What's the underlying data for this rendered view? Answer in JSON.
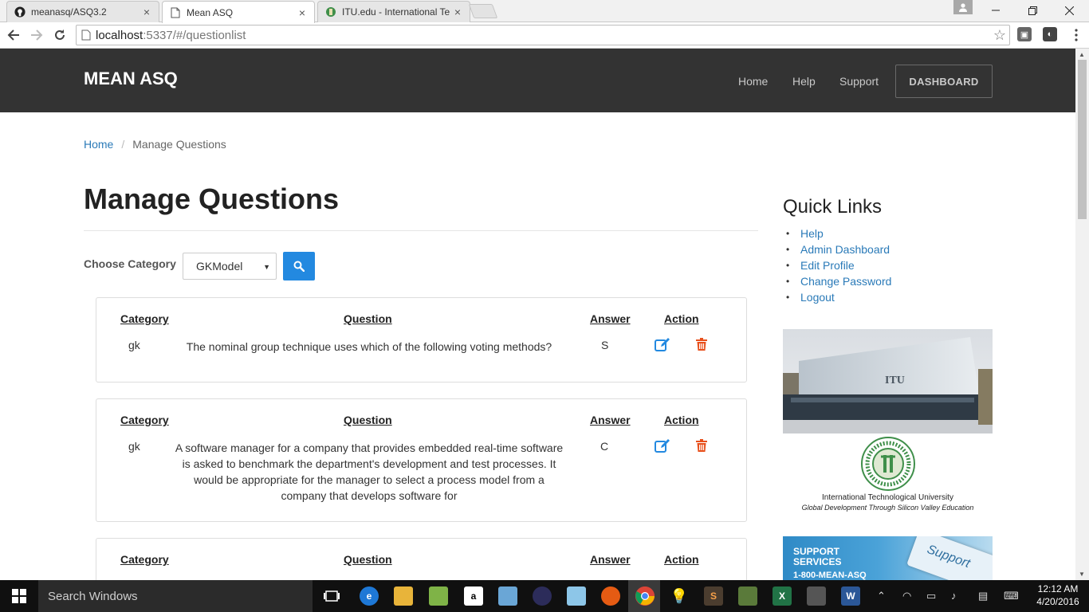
{
  "browser": {
    "tabs": [
      {
        "title": "meanasq/ASQ3.2",
        "icon": "github-icon"
      },
      {
        "title": "Mean ASQ",
        "icon": "page-icon",
        "active": true
      },
      {
        "title": "ITU.edu - International Te",
        "icon": "itu-icon"
      }
    ],
    "close_glyph": "×",
    "url_host": "localhost",
    "url_path": ":5337/#/questionlist"
  },
  "navbar": {
    "brand": "MEAN ASQ",
    "links": [
      "Home",
      "Help",
      "Support"
    ],
    "dashboard_label": "DASHBOARD"
  },
  "breadcrumb": {
    "home": "Home",
    "separator": "/",
    "current": "Manage Questions"
  },
  "main": {
    "title": "Manage Questions",
    "choose_category_label": "Choose Category",
    "selected_category": "GKModel",
    "table_headers": {
      "category": "Category",
      "question": "Question",
      "answer": "Answer",
      "action": "Action"
    },
    "questions": [
      {
        "category": "gk",
        "question": "The nominal group technique uses which of the following voting methods?",
        "answer": "S"
      },
      {
        "category": "gk",
        "question": "A software manager for a company that provides embedded real-time software is asked to benchmark the department's development and test processes. It would be appropriate for the manager to select a process model from a company that develops software for",
        "answer": "C"
      }
    ]
  },
  "sidebar": {
    "quick_links_title": "Quick Links",
    "links": [
      "Help",
      "Admin Dashboard",
      "Edit Profile",
      "Change Password",
      "Logout"
    ],
    "itu_building_sign": "ITU",
    "itu_name": "International Technological University",
    "itu_tagline": "Global Development Through Silicon Valley Education",
    "support_title_line1": "SUPPORT",
    "support_title_line2": "SERVICES",
    "support_phone": "1-800-MEAN-ASQ",
    "support_key_text": "Support"
  },
  "taskbar": {
    "search_placeholder": "Search Windows",
    "time": "12:12 AM",
    "date": "4/20/2016"
  },
  "colors": {
    "navbar_bg": "#333333",
    "link_blue": "#2a7ab8",
    "search_button": "#2389e0",
    "edit_icon": "#2389e0",
    "delete_icon": "#e8501c"
  }
}
